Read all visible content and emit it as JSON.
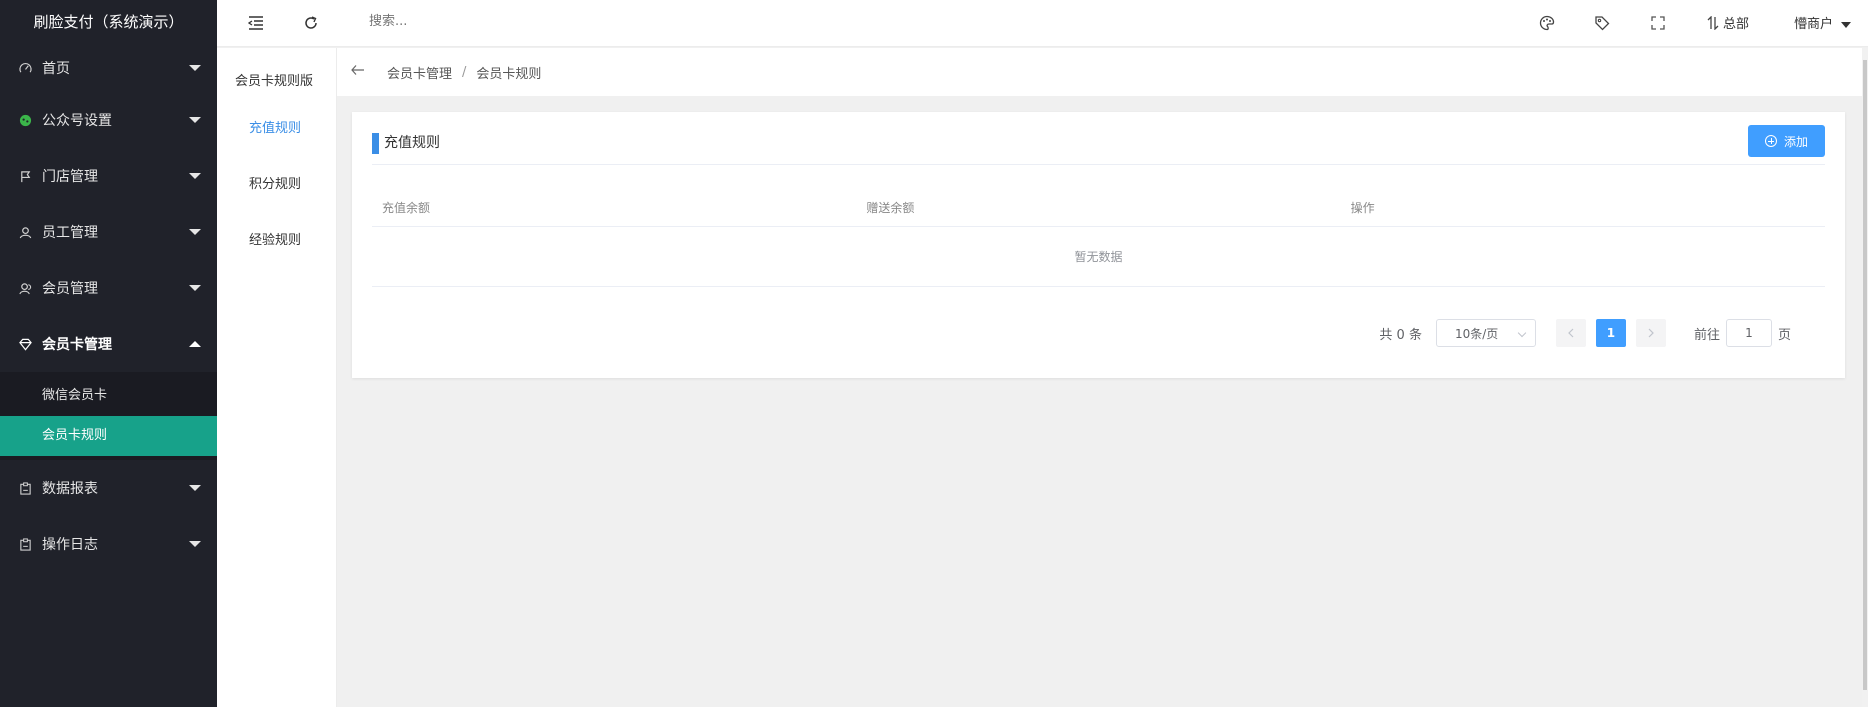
{
  "brand": "刷脸支付（系统演示）",
  "sidebar": {
    "items": [
      {
        "label": "首页",
        "icon": "gauge-icon"
      },
      {
        "label": "公众号设置",
        "icon": "wechat-icon"
      },
      {
        "label": "门店管理",
        "icon": "flag-icon"
      },
      {
        "label": "员工管理",
        "icon": "user-icon"
      },
      {
        "label": "会员管理",
        "icon": "users-icon"
      },
      {
        "label": "会员卡管理",
        "icon": "diamond-icon"
      },
      {
        "label": "数据报表",
        "icon": "clipboard-icon"
      },
      {
        "label": "操作日志",
        "icon": "log-icon"
      }
    ],
    "submenu": [
      {
        "label": "微信会员卡"
      },
      {
        "label": "会员卡规则"
      }
    ]
  },
  "header": {
    "search_placeholder": "搜索...",
    "hq_label": "总部",
    "user_label": "懵商户"
  },
  "subnav": {
    "title": "会员卡规则版",
    "items": [
      {
        "label": "充值规则"
      },
      {
        "label": "积分规则"
      },
      {
        "label": "经验规则"
      }
    ]
  },
  "breadcrumb": {
    "parent": "会员卡管理",
    "sep": "/",
    "current": "会员卡规则"
  },
  "card": {
    "title": "充值规则",
    "add_label": "添加",
    "columns": [
      "充值余额",
      "赠送余额",
      "操作"
    ],
    "empty_text": "暂无数据"
  },
  "pagination": {
    "total_text": "共 0 条",
    "page_size": "10条/页",
    "current_page": "1",
    "goto_label": "前往",
    "goto_value": "1",
    "page_unit": "页"
  },
  "colors": {
    "sidebar_bg": "#20222a",
    "submenu_selected": "#17a28a",
    "primary": "#409eff"
  }
}
